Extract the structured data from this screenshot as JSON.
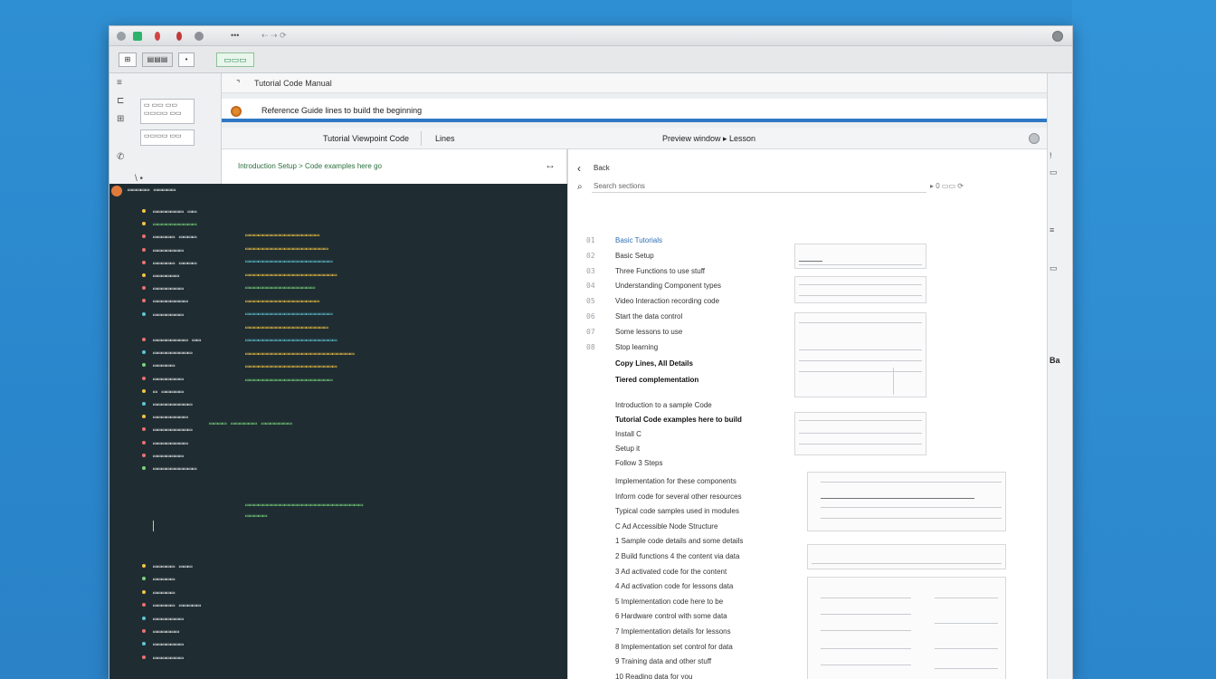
{
  "window": {
    "tabs": [
      "•••"
    ]
  },
  "toolbar": {
    "btn1": "⊞",
    "btn2": "▤▤▤",
    "btn3": "•",
    "green": "▭▭▭"
  },
  "left_rail": {
    "card1_line1": "▭ ▭▭ ▭▭",
    "card1_line2": "▭▭▭▭ ▭▭",
    "card2": "▭▭▭▭ ▭▭",
    "label": "\\ •"
  },
  "header": {
    "breadcrumb": "Tutorial  Code  Manual",
    "notice": "Reference Guide  lines to build the beginning"
  },
  "panel": {
    "tab_left": "Tutorial Viewpoint  Code",
    "tab_mid": "Lines",
    "title": "Preview window  ▸ Lesson"
  },
  "editor": {
    "path": "Introduction  Setup  >  Code  examples  here  go",
    "resize": "↔",
    "code_label": "▭▭▭▭▭ ▭▭▭▭▭"
  },
  "code": {
    "tree": [
      {
        "label": "▭▭▭▭▭▭▭ ▭▭",
        "color": "#e6e6e6",
        "dot": "#f4c542"
      },
      {
        "label": "▭▭▭▭▭▭▭▭▭▭",
        "color": "#7ad67a",
        "dot": "#f4c542"
      },
      {
        "label": "▭▭▭▭▭ ▭▭▭▭",
        "color": "#e6e6e6",
        "dot": "#f07070"
      },
      {
        "label": "▭▭▭▭▭▭▭",
        "color": "#e6e6e6",
        "dot": "#f07070"
      },
      {
        "label": "▭▭▭▭▭ ▭▭▭▭",
        "color": "#e6e6e6",
        "dot": "#f07070"
      },
      {
        "label": "▭▭▭▭▭▭",
        "color": "#e6e6e6",
        "dot": "#f4c542"
      },
      {
        "label": "▭▭▭▭▭▭▭",
        "color": "#e6e6e6",
        "dot": "#f07070"
      },
      {
        "label": "▭▭▭▭▭▭▭▭",
        "color": "#e6e6e6",
        "dot": "#f07070"
      },
      {
        "label": "▭▭▭▭▭▭▭",
        "color": "#e6e6e6",
        "dot": "#5fc7d6"
      },
      {
        "label": "",
        "color": "#e6e6e6",
        "dot": ""
      },
      {
        "label": "▭▭▭▭▭▭▭▭ ▭▭",
        "color": "#e6e6e6",
        "dot": "#f07070"
      },
      {
        "label": "▭▭▭▭▭▭▭▭▭",
        "color": "#e6e6e6",
        "dot": "#5fc7d6"
      },
      {
        "label": "▭▭▭▭▭",
        "color": "#e6e6e6",
        "dot": "#7ad67a"
      },
      {
        "label": "▭▭▭▭▭▭▭",
        "color": "#e6e6e6",
        "dot": "#f07070"
      },
      {
        "label": "▭  ▭▭▭▭▭",
        "color": "#e6e6e6",
        "dot": "#f4c542"
      },
      {
        "label": "▭▭▭▭▭▭▭▭▭",
        "color": "#e6e6e6",
        "dot": "#5fc7d6"
      },
      {
        "label": "▭▭▭▭▭▭▭▭",
        "color": "#e6e6e6",
        "dot": "#f4c542"
      },
      {
        "label": "▭▭▭▭▭▭▭▭▭",
        "color": "#e6e6e6",
        "dot": "#f07070"
      },
      {
        "label": "▭▭▭▭▭▭▭▭",
        "color": "#e6e6e6",
        "dot": "#f07070"
      },
      {
        "label": "▭▭▭▭▭▭▭",
        "color": "#e6e6e6",
        "dot": "#f07070"
      },
      {
        "label": "▭▭▭▭▭▭▭▭▭▭",
        "color": "#e6e6e6",
        "dot": "#7ad67a"
      }
    ],
    "tree_lower": [
      {
        "label": "▭▭▭▭▭ ▭▭▭",
        "dot": "#f4c542"
      },
      {
        "label": "▭▭▭▭▭",
        "dot": "#7ad67a"
      },
      {
        "label": "▭▭▭▭▭",
        "dot": "#f4c542"
      },
      {
        "label": "▭▭▭▭▭ ▭▭▭▭▭",
        "dot": "#f07070"
      },
      {
        "label": "▭▭▭▭▭▭▭",
        "dot": "#5fc7d6"
      },
      {
        "label": "▭▭▭▭▭▭",
        "dot": "#f07070"
      },
      {
        "label": "▭▭▭▭▭▭▭",
        "dot": "#5fc7d6"
      },
      {
        "label": "▭▭▭▭▭▭▭",
        "dot": "#f07070"
      }
    ],
    "lines": [
      {
        "text": "▭▭▭▭▭▭▭▭▭▭▭▭▭▭▭▭▭",
        "color": "#f4c542"
      },
      {
        "text": "▭▭▭▭▭▭▭▭▭▭▭▭▭▭▭▭▭▭▭",
        "color": "#f4c542"
      },
      {
        "text": "▭▭▭▭▭▭▭▭▭▭▭▭▭▭▭▭▭▭▭▭",
        "color": "#5fc7d6"
      },
      {
        "text": "▭▭▭▭▭▭▭▭▭▭▭▭▭▭▭▭▭▭▭▭▭",
        "color": "#f4c542"
      },
      {
        "text": "▭▭▭▭▭▭▭▭▭▭▭▭▭▭▭▭",
        "color": "#7ad67a"
      },
      {
        "text": "▭▭▭▭▭▭▭▭▭▭▭▭▭▭▭▭▭",
        "color": "#f4c542"
      },
      {
        "text": "▭▭▭▭▭▭▭▭▭▭▭▭▭▭▭▭▭▭▭▭",
        "color": "#5fc7d6"
      },
      {
        "text": "▭▭▭▭▭▭▭▭▭▭▭▭▭▭▭▭▭▭▭",
        "color": "#f4c542"
      },
      {
        "text": "▭▭▭▭▭▭▭▭▭▭▭▭▭▭▭▭▭▭▭▭▭",
        "color": "#5fc7d6"
      },
      {
        "text": "▭▭▭▭▭▭▭▭▭▭▭▭▭▭▭▭▭▭▭▭▭▭▭▭▭",
        "color": "#f4c542"
      },
      {
        "text": "▭▭▭▭▭▭▭▭▭▭▭▭▭▭▭▭▭▭▭▭▭",
        "color": "#f4c542"
      },
      {
        "text": "▭▭▭▭▭▭▭▭▭▭▭▭▭▭▭▭▭▭▭▭",
        "color": "#7ad67a"
      }
    ],
    "line_mid": "▭▭▭▭  ▭▭▭▭▭▭  ▭▭▭▭▭▭▭",
    "line_green": "▭▭▭▭▭▭▭▭▭▭▭▭▭▭▭▭▭▭▭▭▭▭▭▭▭▭▭",
    "line_green2": "▭▭▭▭▭"
  },
  "preview": {
    "back_label": "Back",
    "search_placeholder": "Search  sections",
    "search_tools": "▸ 0    ▭▭    ⟳",
    "lesson_items": [
      {
        "num": "01",
        "text": "Basic  Tutorials",
        "style": "link"
      },
      {
        "num": "02",
        "text": "Basic  Setup",
        "style": "plain"
      },
      {
        "num": "03",
        "text": "Three  Functions  to  use  stuff",
        "style": "plain"
      },
      {
        "num": "04",
        "text": "Understanding  Component  types",
        "style": "plain"
      },
      {
        "num": "05",
        "text": "Video  Interaction  recording  code",
        "style": "plain"
      },
      {
        "num": "06",
        "text": "Start  the  data  control",
        "style": "plain"
      },
      {
        "num": "07",
        "text": "Some  lessons  to  use",
        "style": "plain"
      },
      {
        "num": "08",
        "text": "Stop  learning",
        "style": "plain"
      }
    ],
    "heading1": "Copy  Lines,  All  Details",
    "heading2": "Tiered  complementation",
    "steps_a": [
      "Introduction  to  a  sample  Code",
      "Tutorial  Code  examples  here  to  build",
      "Install  C",
      "Setup  it",
      "Follow  3  Steps"
    ],
    "steps_b": [
      "Implementation  for  these  components",
      "Inform  code  for  several  other  resources",
      "Typical  code  samples  used  in  modules",
      "C  Ad  Accessible  Node  Structure",
      "1  Sample  code  details  and  some  details",
      "2  Build  functions  4  the  content  via  data",
      "3  Ad  activated  code  for  the  content",
      "4  Ad  activation  code  for  lessons  data",
      "5  Implementation  code  here  to  be",
      "6  Hardware  control  with  some  data",
      "7  Implementation  details  for  lessons",
      "8  Implementation  set  control  for  data",
      "9  Training  data  and  other  stuff",
      "10  Reading  data  for  you"
    ]
  },
  "right_strip": {
    "icons": [
      "!",
      "▭",
      "≡",
      "▭",
      "Ba"
    ]
  }
}
